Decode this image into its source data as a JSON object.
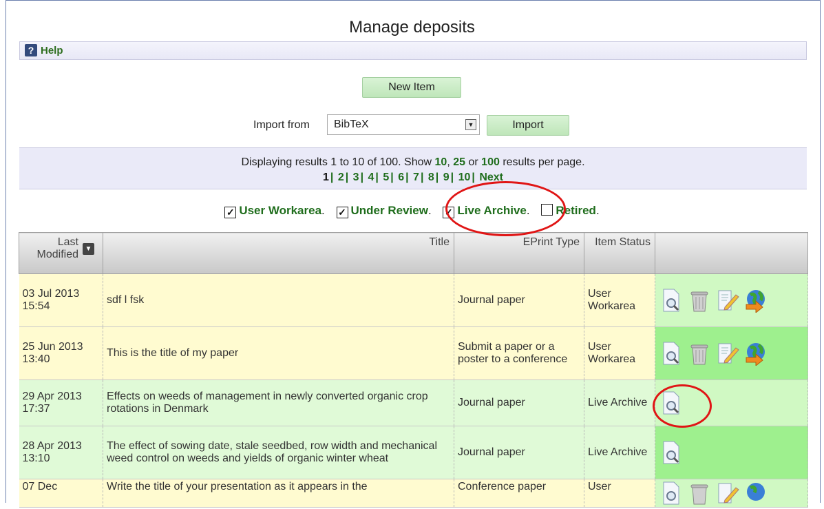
{
  "page": {
    "title": "Manage deposits",
    "help_label": "Help",
    "new_item_label": "New Item",
    "import_from_label": "Import from",
    "import_select_value": "BibTeX",
    "import_button_label": "Import"
  },
  "results": {
    "summary_prefix": "Displaying results 1 to 10 of 100. Show",
    "per_page_options": [
      "10",
      "25",
      "100"
    ],
    "summary_or": "or",
    "summary_suffix": "results per page.",
    "pages": [
      "1",
      "2",
      "3",
      "4",
      "5",
      "6",
      "7",
      "8",
      "9",
      "10"
    ],
    "next_label": "Next"
  },
  "filters": [
    {
      "label": "User Workarea",
      "checked": true
    },
    {
      "label": "Under Review",
      "checked": true
    },
    {
      "label": "Live Archive",
      "checked": true
    },
    {
      "label": "Retired",
      "checked": false
    }
  ],
  "table": {
    "headers": {
      "last_modified": "Last Modified",
      "title": "Title",
      "eprint_type": "EPrint Type",
      "item_status": "Item Status"
    },
    "rows": [
      {
        "date": "03 Jul 2013",
        "time": "15:54",
        "title": "sdf l fsk",
        "type": "Journal paper",
        "status": "User Workarea",
        "actions": [
          "view-icon",
          "delete-icon",
          "edit-icon",
          "deposit-icon"
        ]
      },
      {
        "date": "25 Jun 2013",
        "time": "13:40",
        "title": "This is the title of my paper",
        "type": "Submit a paper or a poster to a conference",
        "status": "User Workarea",
        "actions": [
          "view-icon",
          "delete-icon",
          "edit-icon",
          "deposit-icon"
        ]
      },
      {
        "date": "29 Apr 2013",
        "time": "17:37",
        "title": "Effects on weeds of management in newly converted organic crop rotations in Denmark",
        "type": "Journal paper",
        "status": "Live Archive",
        "actions": [
          "view-icon"
        ]
      },
      {
        "date": "28 Apr 2013",
        "time": "13:10",
        "title": "The effect of sowing date, stale seedbed, row width and mechanical weed control on weeds and yields of organic winter wheat",
        "type": "Journal paper",
        "status": "Live Archive",
        "actions": [
          "view-icon"
        ]
      },
      {
        "date": "07 Dec",
        "time": "",
        "title": "Write the title of your presentation as it appears in the",
        "type": "Conference paper",
        "status": "User",
        "actions": [
          "view-icon",
          "delete-icon",
          "edit-icon",
          "deposit-icon"
        ]
      }
    ]
  },
  "colors": {
    "accent_green": "#1f6d1c",
    "row_workarea": "#fffbd0",
    "row_archive": "#e0fad7",
    "annotation_red": "#e01515"
  }
}
